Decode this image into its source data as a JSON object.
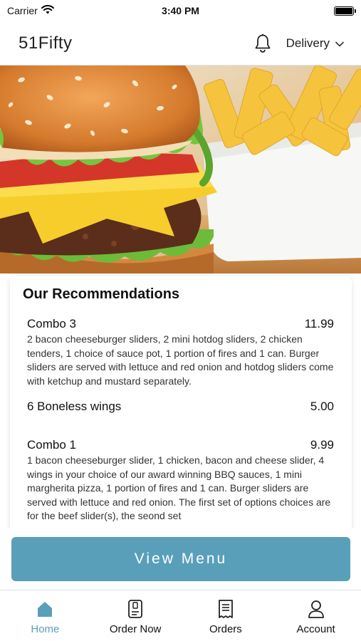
{
  "status_bar": {
    "carrier": "Carrier",
    "time": "3:40 PM"
  },
  "header": {
    "brand": "51Fifty",
    "mode_label": "Delivery",
    "icons": [
      "bell-icon",
      "chevron-down-icon"
    ]
  },
  "recommendations": {
    "title": "Our Recommendations",
    "items": [
      {
        "name": "Combo 3",
        "price": "11.99",
        "description": "2 bacon cheeseburger sliders, 2 mini hotdog sliders, 2 chicken tenders, 1 choice of sauce pot, 1 portion of fires and 1 can. Burger sliders are served with lettuce and red onion and hotdog sliders come with ketchup and mustard separately."
      },
      {
        "name": "6 Boneless wings",
        "price": "5.00",
        "description": ""
      },
      {
        "name": "Combo 1",
        "price": "9.99",
        "description": "1 bacon cheeseburger slider, 1 chicken, bacon and cheese slider, 4 wings in your choice of our award winning BBQ sauces, 1 mini margherita pizza, 1 portion of fires and 1 can. Burger sliders are served with lettuce and red onion. The first set of options choices are for the beef slider(s), the seond set"
      }
    ]
  },
  "cta": {
    "view_menu_label": "View Menu",
    "color": "#5a9fba"
  },
  "tab_bar": {
    "active": "Home",
    "tabs": [
      {
        "label": "Home",
        "icon": "home-icon"
      },
      {
        "label": "Order Now",
        "icon": "order-list-icon"
      },
      {
        "label": "Orders",
        "icon": "receipt-icon"
      },
      {
        "label": "Account",
        "icon": "person-icon"
      }
    ]
  }
}
